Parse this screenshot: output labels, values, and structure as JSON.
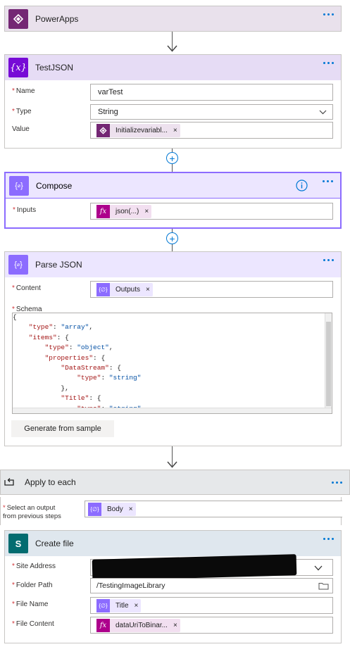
{
  "colors": {
    "powerapps": "#742774",
    "variable": "#770bd6",
    "compose": "#8c6cff",
    "expression": "#ad008c",
    "sharepoint": "#036c70",
    "accent": "#0078d4",
    "required": "#d13438"
  },
  "trigger": {
    "title": "PowerApps",
    "icon": "powerapps-icon"
  },
  "init_var": {
    "title": "TestJSON",
    "icon": "variable-icon",
    "name_label": "Name",
    "name_value": "varTest",
    "type_label": "Type",
    "type_value": "String",
    "value_label": "Value",
    "value_token": "Initializevariabl..."
  },
  "compose": {
    "title": "Compose",
    "icon": "compose-icon",
    "inputs_label": "Inputs",
    "inputs_token": "json(...)"
  },
  "parse": {
    "title": "Parse JSON",
    "icon": "parse-json-icon",
    "content_label": "Content",
    "content_token": "Outputs",
    "schema_label": "Schema",
    "schema_lines": [
      "{",
      "    \"type\": \"array\",",
      "    \"items\": {",
      "        \"type\": \"object\",",
      "        \"properties\": {",
      "            \"DataStream\": {",
      "                \"type\": \"string\"",
      "            },",
      "            \"Title\": {",
      "                \"type\": \"string\""
    ],
    "generate_button": "Generate from sample"
  },
  "apply": {
    "title": "Apply to each",
    "icon": "loop-icon",
    "select_label_line1": "Select an output",
    "select_label_line2": "from previous steps",
    "select_token": "Body"
  },
  "create_file": {
    "title": "Create file",
    "icon": "sharepoint-icon",
    "site_label": "Site Address",
    "folder_label": "Folder Path",
    "folder_value": "/TestingImageLibrary",
    "filename_label": "File Name",
    "filename_token": "Title",
    "content_label": "File Content",
    "content_token": "dataUriToBinar..."
  },
  "token_close": "×"
}
